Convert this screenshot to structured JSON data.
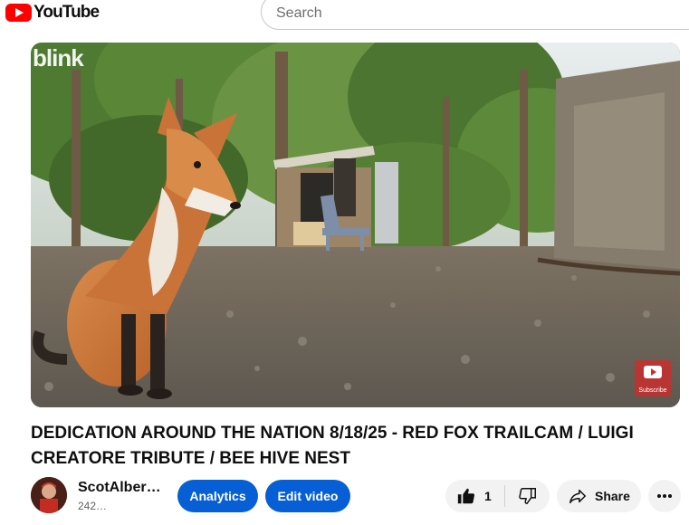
{
  "header": {
    "logo_text": "YouTube",
    "search_placeholder": "Search"
  },
  "video": {
    "watermark": "blink",
    "subscribe_watermark": "Subscribe"
  },
  "title": "DEDICATION AROUND THE NATION 8/18/25 - RED FOX TRAILCAM / LUIGI CREATORE TRIBUTE / BEE HIVE NEST",
  "owner": {
    "channel_name": "ScotAlber…",
    "subscribers": "242…"
  },
  "actions": {
    "analytics_label": "Analytics",
    "edit_label": "Edit video",
    "like_count": "1",
    "share_label": "Share"
  },
  "colors": {
    "brand_red": "#ff0000",
    "button_blue": "#065fd4",
    "pill_gray": "#f2f2f2"
  },
  "icons": [
    "youtube-logo-icon",
    "thumbs-up-icon",
    "thumbs-down-icon",
    "share-icon",
    "more-icon"
  ]
}
